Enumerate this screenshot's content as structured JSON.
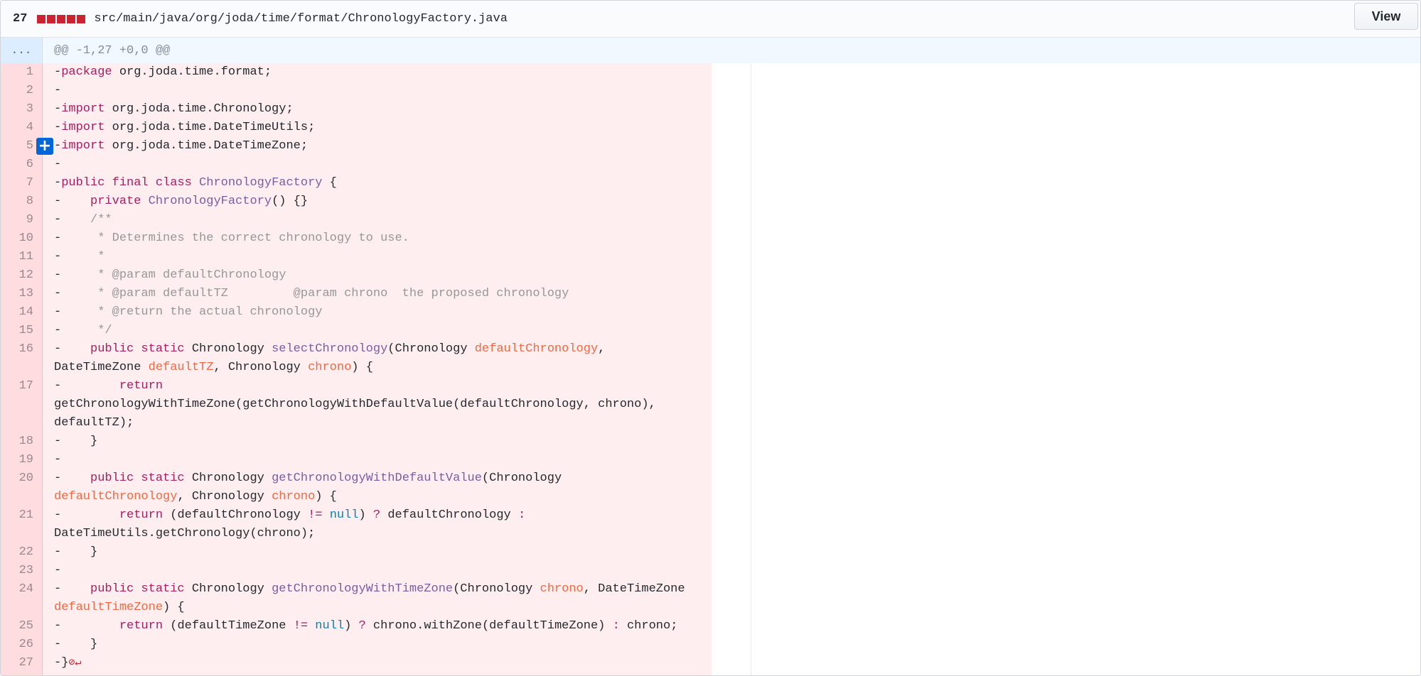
{
  "header": {
    "change_count": "27",
    "file_path": "src/main/java/org/joda/time/format/ChronologyFactory.java",
    "view_label": "View",
    "diffstat_color": "#cb2431"
  },
  "hunk": {
    "expander": "...",
    "text": "@@ -1,27 +0,0 @@"
  },
  "add_line_button": {
    "label": "+"
  },
  "line_numbers": [
    "1",
    "2",
    "3",
    "4",
    "5",
    "6",
    "7",
    "8",
    "9",
    "10",
    "11",
    "12",
    "13",
    "14",
    "15",
    "16",
    "17",
    "18",
    "19",
    "20",
    "21",
    "22",
    "23",
    "24",
    "25",
    "26",
    "27"
  ],
  "colors": {
    "deleted_code_bg": "#ffeef0",
    "deleted_gutter_bg": "#ffdce0",
    "keyword": "#a71d5d",
    "type": "#795da3",
    "variable": "#ed6a43",
    "comment": "#969896",
    "constant": "#0086b3"
  },
  "code": {
    "l1_kw": "package",
    "l1_rest": " org.joda.time.format;",
    "l3_kw": "import",
    "l3_rest": " org.joda.time.Chronology;",
    "l4_kw": "import",
    "l4_rest": " org.joda.time.DateTimeUtils;",
    "l5_kw": "import",
    "l5_rest": " org.joda.time.DateTimeZone;",
    "l7_kw": "public final class",
    "l7_type": "ChronologyFactory",
    "l7_rest": " {",
    "l8_kw": "private",
    "l8_type": "ChronologyFactory",
    "l8_rest": "() {}",
    "l9_c": "/**",
    "l10_c": " * Determines the correct chronology to use.",
    "l11_c": " *",
    "l12_c": " * @param defaultChronology",
    "l13_c": " * @param defaultTZ         @param chrono  the proposed chronology",
    "l14_c": " * @return the actual chronology",
    "l15_c": " */",
    "l16_kw": "public static",
    "l16_a": " Chronology ",
    "l16_fn": "selectChronology",
    "l16_b": "(Chronology ",
    "l16_v1": "defaultChronology",
    "l16_c": ",",
    "l16w_a": "DateTimeZone ",
    "l16w_v2": "defaultTZ",
    "l16w_b": ", Chronology ",
    "l16w_v3": "chrono",
    "l16w_c": ") {",
    "l17_kw": "return",
    "l17w1": "getChronologyWithTimeZone(getChronologyWithDefaultValue(defaultChronology, chrono),",
    "l17w2": "defaultTZ);",
    "l18": "}",
    "l20_kw": "public static",
    "l20_a": " Chronology ",
    "l20_fn": "getChronologyWithDefaultValue",
    "l20_b": "(Chronology",
    "l20w_v1": "defaultChronology",
    "l20w_a": ", Chronology ",
    "l20w_v2": "chrono",
    "l20w_b": ") {",
    "l21_kw": "return",
    "l21_a": " (defaultChronology ",
    "l21_op1": "!=",
    "l21_sp": " ",
    "l21_null": "null",
    "l21_b": ") ",
    "l21_op2": "?",
    "l21_c": " defaultChronology ",
    "l21_op3": ":",
    "l21w": "DateTimeUtils.getChronology(chrono);",
    "l22": "}",
    "l24_kw": "public static",
    "l24_a": " Chronology ",
    "l24_fn": "getChronologyWithTimeZone",
    "l24_b": "(Chronology ",
    "l24_v1": "chrono",
    "l24_c": ", DateTimeZone",
    "l24w_v2": "defaultTimeZone",
    "l24w_a": ") {",
    "l25_kw": "return",
    "l25_a": " (defaultTimeZone ",
    "l25_op1": "!=",
    "l25_sp": " ",
    "l25_null": "null",
    "l25_b": ") ",
    "l25_op2": "?",
    "l25_c": " chrono.withZone(defaultTimeZone) ",
    "l25_op3": ":",
    "l25_d": " chrono;",
    "l26": "}",
    "l27": "}",
    "l27_noeol": "⊘↵"
  }
}
